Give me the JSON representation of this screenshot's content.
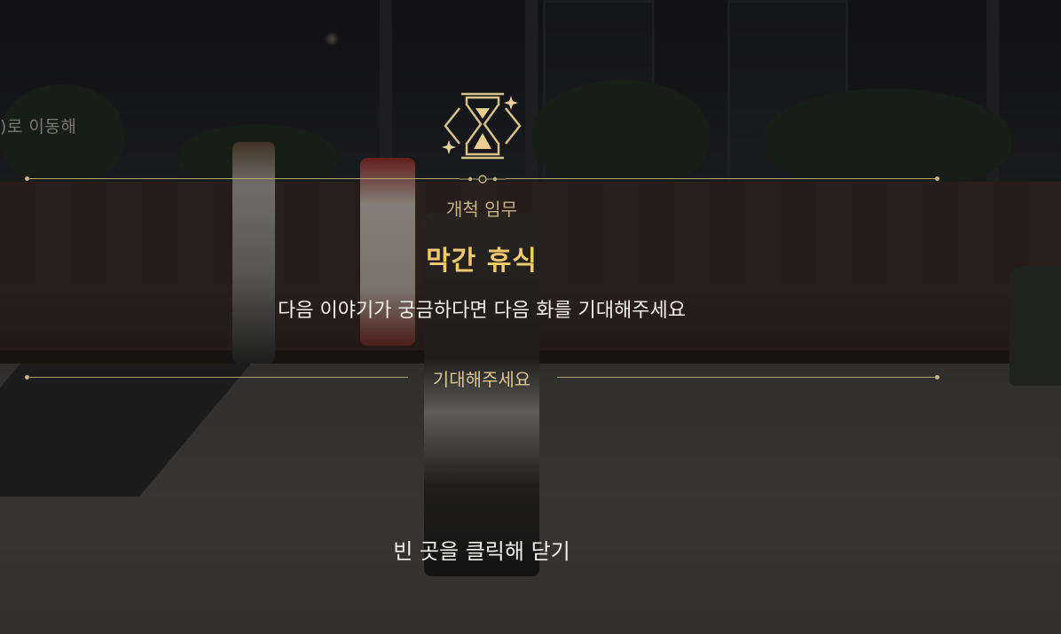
{
  "background": {
    "offscreen_hint": ")로 이동해"
  },
  "mission": {
    "icon": "hourglass-icon",
    "type_label": "개척 임무",
    "title": "막간 휴식",
    "description": "다음 이야기가 궁금하다면 다음 화를 기대해주세요",
    "status_label": "기대해주세요"
  },
  "footer": {
    "close_hint": "빈 곳을 클릭해 닫기"
  },
  "colors": {
    "accent_gold": "#f2c86e",
    "ornament_gold": "#c5b38a",
    "text_white": "#f3f1ec"
  }
}
